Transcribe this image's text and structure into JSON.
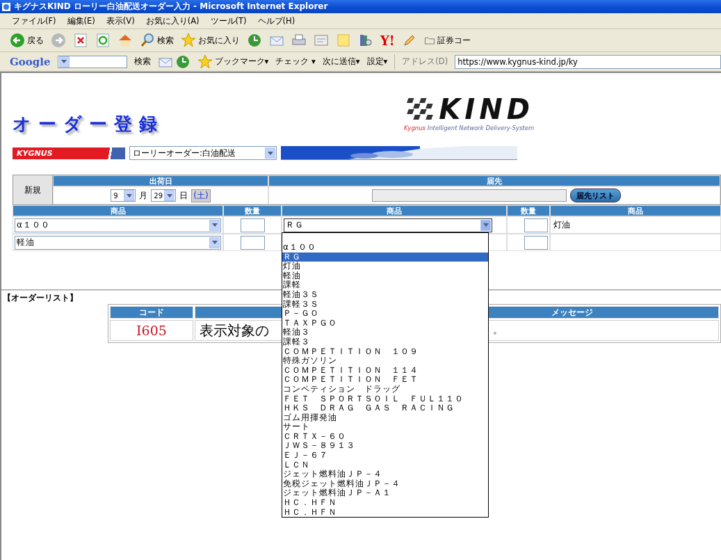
{
  "window": {
    "title": "キグナスKIND ローリー白油配送オーダー入力 - Microsoft Internet Explorer"
  },
  "menu": [
    "ファイル(F)",
    "編集(E)",
    "表示(V)",
    "お気に入り(A)",
    "ツール(T)",
    "ヘルプ(H)"
  ],
  "toolbar": [
    {
      "kind": "back",
      "label": "戻る"
    },
    {
      "kind": "forward"
    },
    {
      "kind": "stop"
    },
    {
      "kind": "refresh"
    },
    {
      "kind": "home"
    },
    {
      "kind": "search",
      "label": "検索"
    },
    {
      "kind": "star",
      "label": "お気に入り"
    },
    {
      "kind": "history"
    },
    {
      "kind": "mail"
    },
    {
      "kind": "print"
    },
    {
      "kind": "edit"
    },
    {
      "kind": "note"
    },
    {
      "kind": "research"
    },
    {
      "kind": "yahoo",
      "label": "Y!"
    },
    {
      "kind": "pen"
    },
    {
      "kind": "folder",
      "label": "証券コー"
    }
  ],
  "google_bar": {
    "logo": "Google",
    "items": [
      {
        "kind": "button",
        "label": "検索"
      },
      {
        "kind": "icons"
      },
      {
        "kind": "bookmark",
        "label": "ブックマーク▾"
      },
      {
        "kind": "check",
        "label": "チェック ▾"
      },
      {
        "kind": "send",
        "label": "次に送信▾"
      },
      {
        "kind": "settings",
        "label": "設定▾"
      }
    ],
    "address_label": "アドレス(D)",
    "url": "https://www.kygnus-kind.jp/ky"
  },
  "page": {
    "title": "オーダー登録",
    "logo": {
      "word": "KIND",
      "tagline_brand": "Kygnus",
      "tagline_rest": " Intelligent Network Delivery-System"
    },
    "brand": "KYGNUS",
    "order_type": "ローリーオーダー:白油配送",
    "form": {
      "mode": "新規",
      "ship_date": {
        "header": "出荷日",
        "month": "9",
        "month_unit": "月",
        "day": "29",
        "day_unit": "日",
        "weekday": "(土)"
      },
      "destination": {
        "header": "届先",
        "button": "届先リスト"
      },
      "columns": [
        "商品",
        "数量",
        "商品",
        "数量",
        "商品"
      ],
      "rows": [
        {
          "cells": [
            {
              "kind": "select",
              "value": "α１００",
              "expanded": false
            },
            {
              "kind": "qty"
            },
            {
              "kind": "select",
              "value": "ＲＧ",
              "expanded": true
            },
            {
              "kind": "qty"
            },
            {
              "kind": "text",
              "value": "灯油"
            }
          ]
        },
        {
          "cells": [
            {
              "kind": "select",
              "value": "軽油",
              "expanded": false
            },
            {
              "kind": "qty"
            },
            {
              "kind": "covered"
            },
            {
              "kind": "qty"
            },
            {
              "kind": "blank"
            }
          ]
        }
      ],
      "options": [
        {
          "label": "α１００",
          "selected": false
        },
        {
          "label": "ＲＧ",
          "selected": true
        },
        {
          "label": "灯油",
          "selected": false
        },
        {
          "label": "軽油",
          "selected": false
        },
        {
          "label": "課軽",
          "selected": false
        },
        {
          "label": "軽油３Ｓ",
          "selected": false
        },
        {
          "label": "課軽３Ｓ",
          "selected": false
        },
        {
          "label": "Ｐ－ＧＯ",
          "selected": false
        },
        {
          "label": "ＴＡＸＰＧＯ",
          "selected": false
        },
        {
          "label": "軽油３",
          "selected": false
        },
        {
          "label": "課軽３",
          "selected": false
        },
        {
          "label": "ＣＯＭＰＥＴＩＴＩＯＮ　１０９",
          "selected": false
        },
        {
          "label": "特殊ガソリン",
          "selected": false
        },
        {
          "label": "ＣＯＭＰＥＴＩＴＩＯＮ　１１４",
          "selected": false
        },
        {
          "label": "ＣＯＭＰＥＴＩＴＩＯＮ　ＦＥＴ",
          "selected": false
        },
        {
          "label": "コンペティション　ドラッグ",
          "selected": false
        },
        {
          "label": "ＦＥＴ　ＳＰＯＲＴＳＯＩＬ　ＦＵＬ１１０",
          "selected": false
        },
        {
          "label": "ＨＫＳ　ＤＲＡＧ　ＧＡＳ　ＲＡＣＩＮＧ",
          "selected": false
        },
        {
          "label": "ゴム用揮発油",
          "selected": false
        },
        {
          "label": "サート",
          "selected": false
        },
        {
          "label": "ＣＲＴＸ－６０",
          "selected": false
        },
        {
          "label": "ＪＷＳ－８９１３",
          "selected": false
        },
        {
          "label": "ＥＪ－６７",
          "selected": false
        },
        {
          "label": "ＬＣＮ",
          "selected": false
        },
        {
          "label": "ジェット燃料油ＪＰ－４",
          "selected": false
        },
        {
          "label": "免税ジェット燃料油ＪＰ－４",
          "selected": false
        },
        {
          "label": "ジェット燃料油ＪＰ－Ａ１",
          "selected": false
        },
        {
          "label": "ＨＣ．ＨＦＮ",
          "selected": false
        },
        {
          "label": "ＨＣ．ＨＦＮ",
          "selected": false
        }
      ]
    },
    "order_list": {
      "title": "【オーダーリスト】",
      "columns": [
        "コード",
        "メッセージ"
      ],
      "rows": [
        {
          "code": "I605",
          "message_start": "表示対象の",
          "message_end": "。"
        }
      ]
    }
  }
}
